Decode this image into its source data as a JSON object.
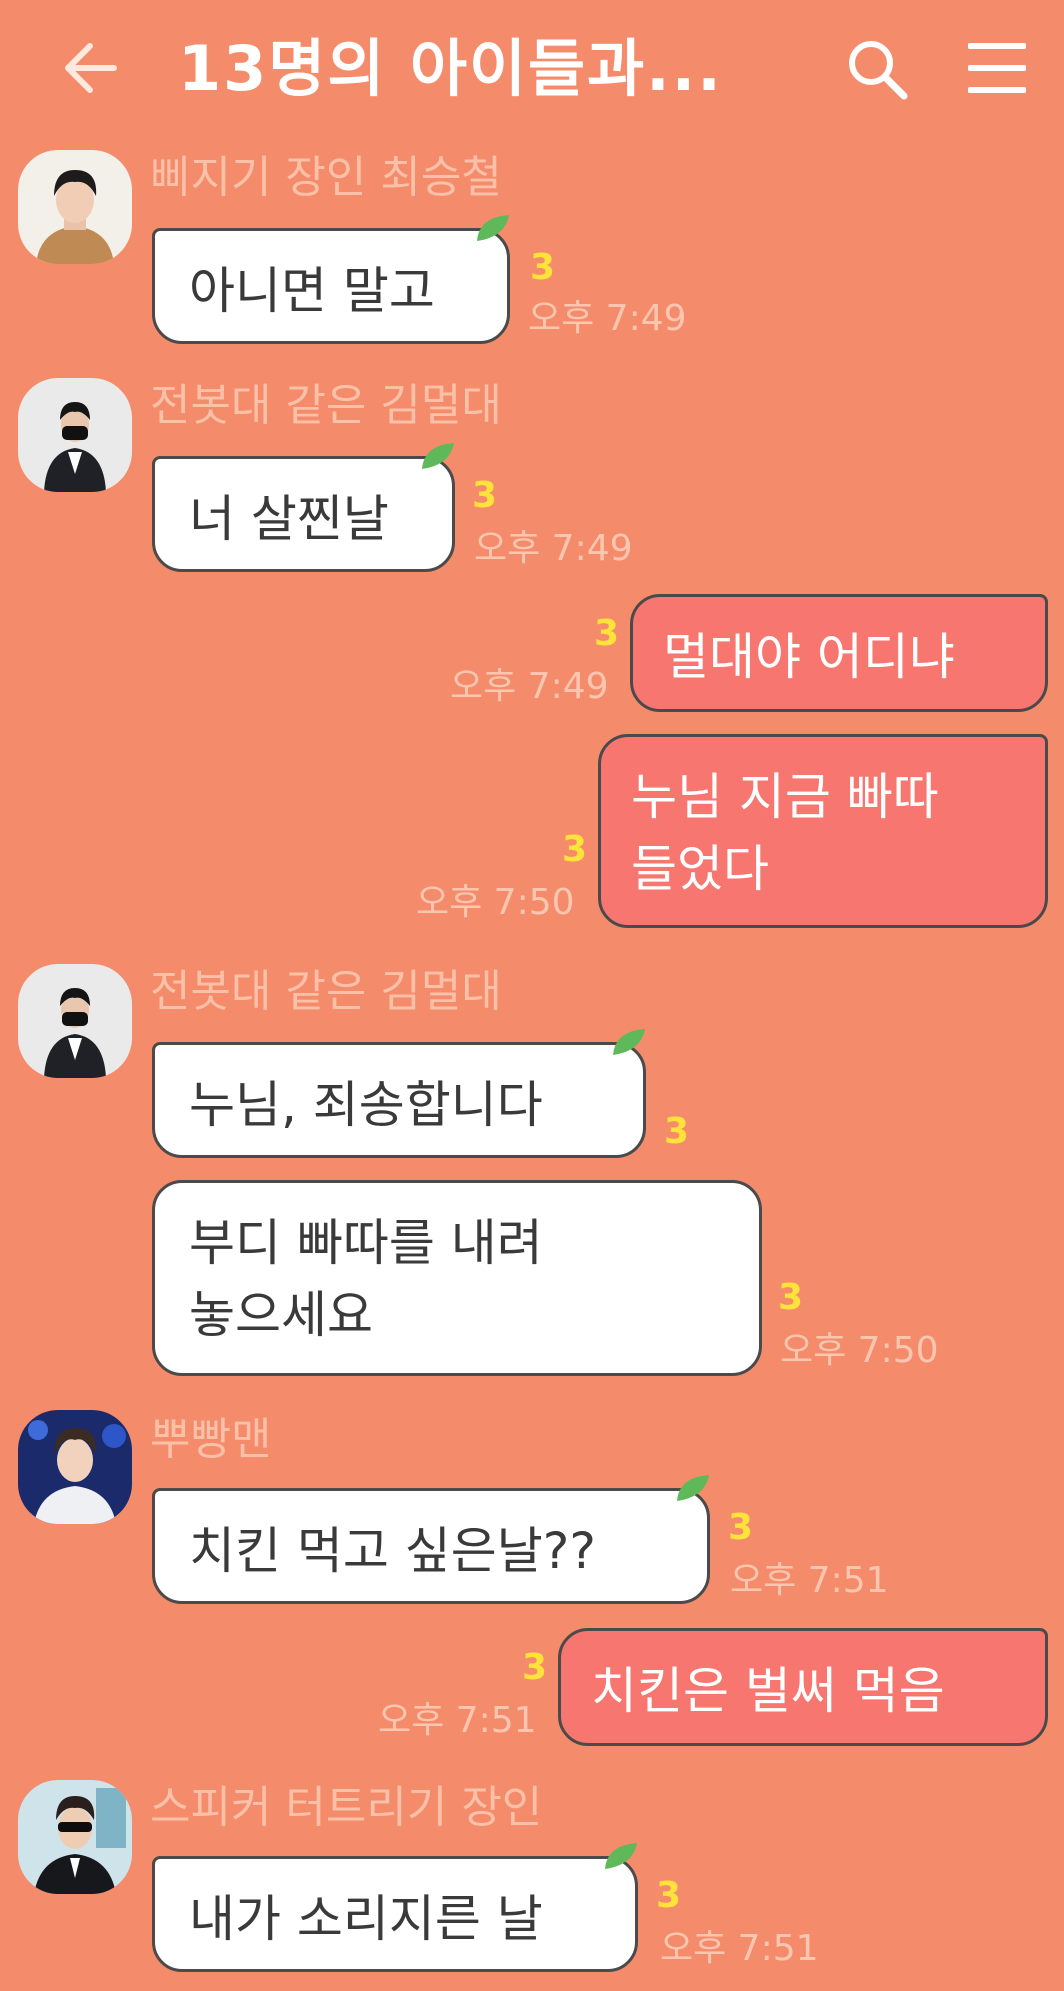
{
  "header": {
    "title": "13명의 아이들과...",
    "back_icon": "arrow-left-icon",
    "search_icon": "search-icon",
    "menu_icon": "hamburger-menu-icon"
  },
  "colors": {
    "background": "#f48c6c",
    "incoming_bubble": "#ffffff",
    "outgoing_bubble": "#f7766f",
    "unread": "#ffe23a",
    "sender_name": "#fbc0a8",
    "timestamp": "#fbc6b0"
  },
  "messages": [
    {
      "sender": "삐지기 장인 최승철",
      "text": "아니면 말고",
      "unread": "3",
      "time": "오후 7:49"
    },
    {
      "sender": "전봇대 같은 김멀대",
      "text": "너 살찐날",
      "unread": "3",
      "time": "오후 7:49"
    },
    {
      "text": "멀대야 어디냐",
      "unread": "3",
      "time": "오후 7:49"
    },
    {
      "line1": "누님 지금 빠따",
      "line2": "들었다",
      "unread": "3",
      "time": "오후 7:50"
    },
    {
      "sender": "전봇대 같은 김멀대",
      "text": "누님, 죄송합니다",
      "unread": "3"
    },
    {
      "line1": "부디 빠따를 내려",
      "line2": "놓으세요",
      "unread": "3",
      "time": "오후 7:50"
    },
    {
      "sender": "뿌빵맨",
      "text": "치킨 먹고 싶은날??",
      "unread": "3",
      "time": "오후 7:51"
    },
    {
      "text": "치킨은 벌써 먹음",
      "unread": "3",
      "time": "오후 7:51"
    },
    {
      "sender": "스피커 터트리기 장인",
      "text": "내가 소리지른 날",
      "unread": "3",
      "time": "오후 7:51"
    }
  ]
}
